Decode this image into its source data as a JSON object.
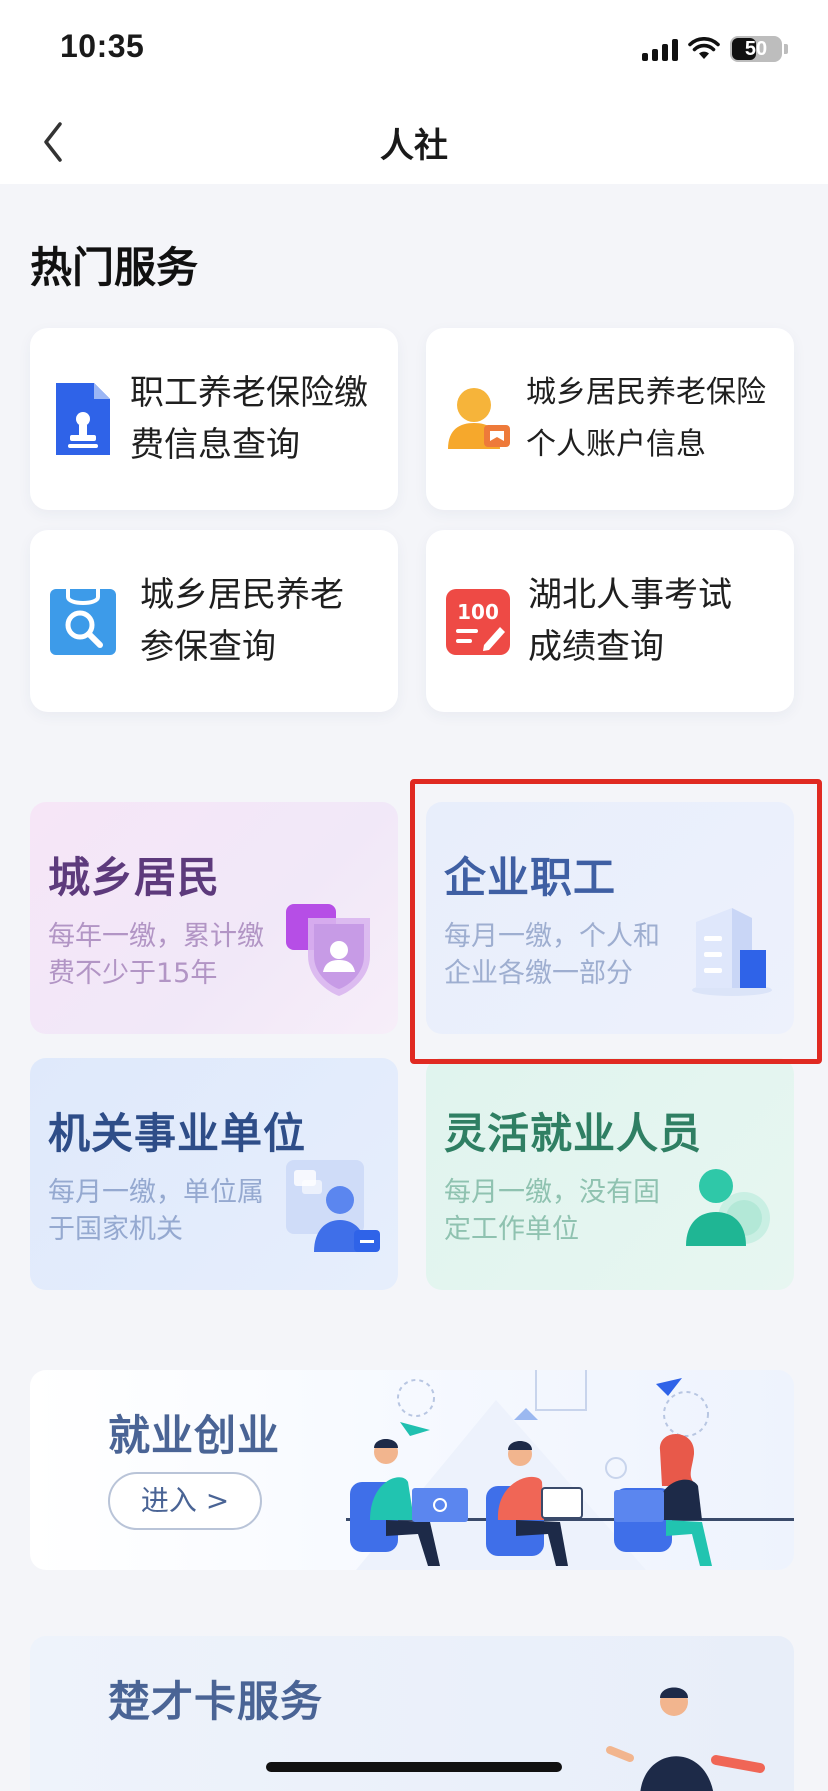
{
  "status_bar": {
    "time": "10:35",
    "battery": "50",
    "battery_level": 0.5
  },
  "nav": {
    "title": "人社"
  },
  "hot_services": {
    "title": "热门服务",
    "items": [
      {
        "label": "职工养老保险缴费信息查询",
        "line1": "职工养老保险缴",
        "line2": "费信息查询",
        "icon": "document-stamp-icon"
      },
      {
        "label": "城乡居民养老保险个人账户信息",
        "line1": "城乡居民养老保险",
        "line2": "个人账户信息",
        "icon": "person-account-icon"
      },
      {
        "label": "城乡居民养老参保查询",
        "line1": "城乡居民养老",
        "line2": "参保查询",
        "icon": "search-clipboard-icon"
      },
      {
        "label": "湖北人事考试成绩查询",
        "line1": "湖北人事考试",
        "line2": "成绩查询",
        "icon": "score-100-icon"
      }
    ]
  },
  "categories": [
    {
      "title": "城乡居民",
      "desc_line1": "每年一缴，累计缴",
      "desc_line2": "费不少于15年",
      "icon": "shield-person-icon"
    },
    {
      "title": "企业职工",
      "desc_line1": "每月一缴，个人和",
      "desc_line2": "企业各缴一部分",
      "icon": "building-icon"
    },
    {
      "title": "机关事业单位",
      "desc_line1": "每月一缴，单位属",
      "desc_line2": "于国家机关",
      "icon": "user-chat-icon"
    },
    {
      "title": "灵活就业人员",
      "desc_line1": "每月一缴，没有固",
      "desc_line2": "定工作单位",
      "icon": "person-disc-icon"
    }
  ],
  "banners": [
    {
      "title": "就业创业",
      "button": "进入 >"
    },
    {
      "title": "楚才卡服务"
    }
  ],
  "colors": {
    "highlight": "#e02a22",
    "blue_icon": "#2f63e8",
    "orange_icon": "#f6b43a",
    "red_icon": "#ee4a45"
  }
}
